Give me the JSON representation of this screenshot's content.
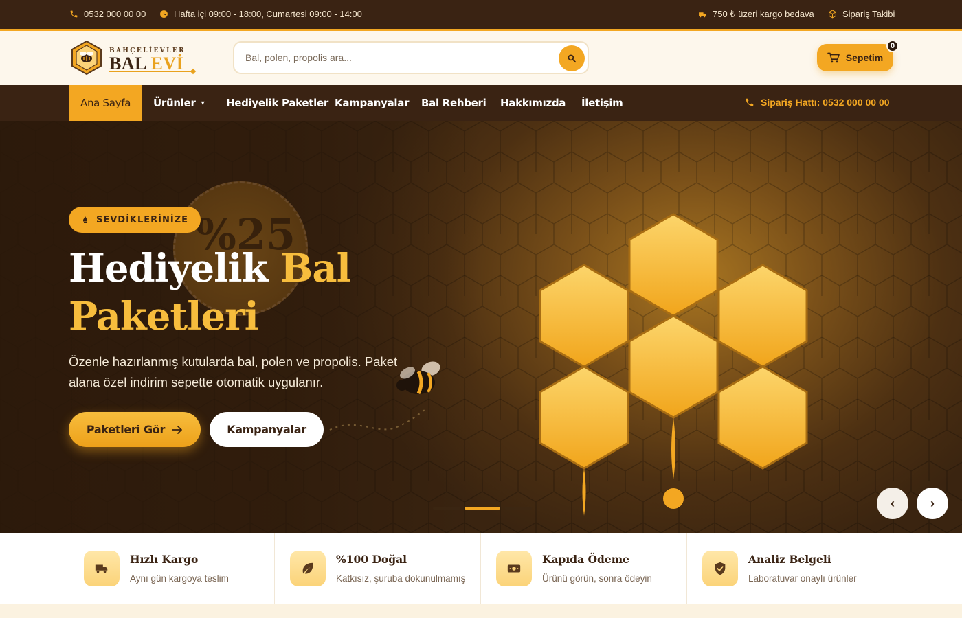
{
  "topbar": {
    "phone": "0532 000 00 00",
    "hours": "Hafta içi 09:00 - 18:00, Cumartesi 09:00 - 14:00",
    "shipping": "750 ₺ üzeri kargo bedava",
    "order_tracking": "Sipariş Takibi"
  },
  "logo": {
    "small": "BAHÇELİEVLER",
    "big_1": "BAL",
    "big_2": "EVİ"
  },
  "search": {
    "placeholder": "Bal, polen, propolis ara..."
  },
  "cart": {
    "label": "Sepetim",
    "count": "0"
  },
  "nav": {
    "items": [
      {
        "label": "Ana Sayfa"
      },
      {
        "label": "Ürünler"
      },
      {
        "label": "Hediyelik Paketler"
      },
      {
        "label": "Kampanyalar"
      },
      {
        "label": "Bal Rehberi"
      },
      {
        "label": "Hakkımızda"
      },
      {
        "label": "İletişim"
      }
    ],
    "order_line": "Sipariş Hattı: 0532 000 00 00"
  },
  "hero": {
    "badge": "SEVDİKLERİNİZE",
    "stamp": "%25",
    "title_white": "Hediyelik",
    "title_gold_1": "Bal",
    "title_gold_2": "Paketleri",
    "description": "Özenle hazırlanmış kutularda bal, polen ve propolis. Paket alana özel indirim sepette otomatik uygulanır.",
    "primary_button": "Paketleri Gör",
    "secondary_button": "Kampanyalar",
    "slides_total": 3,
    "active_slide": 2
  },
  "features": [
    {
      "title": "Hızlı Kargo",
      "desc": "Aynı gün kargoya teslim",
      "icon": "truck-icon"
    },
    {
      "title": "%100 Doğal",
      "desc": "Katkısız, şuruba dokunulmamış",
      "icon": "leaf-icon"
    },
    {
      "title": "Kapıda Ödeme",
      "desc": "Ürünü görün, sonra ödeyin",
      "icon": "cash-icon"
    },
    {
      "title": "Analiz Belgeli",
      "desc": "Laboratuvar onaylı ürünler",
      "icon": "shield-check-icon"
    }
  ],
  "colors": {
    "brand_dark": "#3a2313",
    "accent": "#f3a722",
    "gold_text": "#f7bd3d"
  }
}
